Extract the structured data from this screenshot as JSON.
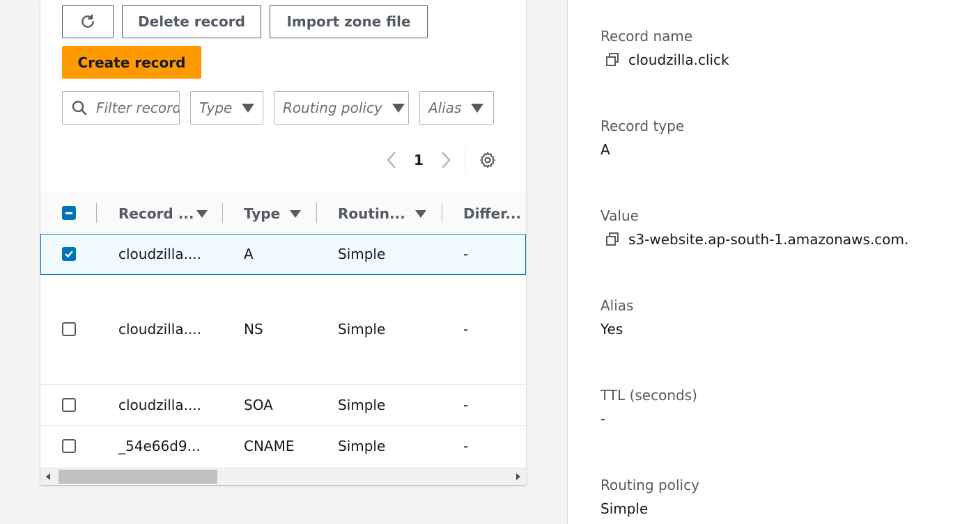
{
  "toolbar": {
    "delete_label": "Delete record",
    "import_label": "Import zone file",
    "create_label": "Create record"
  },
  "filters": {
    "search_placeholder": "Filter records",
    "type_label": "Type",
    "routing_label": "Routing policy",
    "alias_label": "Alias"
  },
  "pagination": {
    "current_page": "1"
  },
  "table": {
    "columns": [
      "Record ...",
      "Type",
      "Routin...",
      "Differ..."
    ],
    "rows": [
      {
        "name": "cloudzilla....",
        "type": "A",
        "routing": "Simple",
        "diff": "-",
        "checked": true
      },
      {
        "name": "cloudzilla....",
        "type": "NS",
        "routing": "Simple",
        "diff": "-",
        "checked": false
      },
      {
        "name": "cloudzilla....",
        "type": "SOA",
        "routing": "Simple",
        "diff": "-",
        "checked": false
      },
      {
        "name": "_54e66d9...",
        "type": "CNAME",
        "routing": "Simple",
        "diff": "-",
        "checked": false
      }
    ]
  },
  "details": {
    "record_name_label": "Record name",
    "record_name_value": "cloudzilla.click",
    "record_type_label": "Record type",
    "record_type_value": "A",
    "value_label": "Value",
    "value_value": "s3-website.ap-south-1.amazonaws.com.",
    "alias_label": "Alias",
    "alias_value": "Yes",
    "ttl_label": "TTL (seconds)",
    "ttl_value": "-",
    "routing_label": "Routing policy",
    "routing_value": "Simple"
  },
  "colors": {
    "primary": "#ff9900",
    "selection": "#0073bb"
  }
}
